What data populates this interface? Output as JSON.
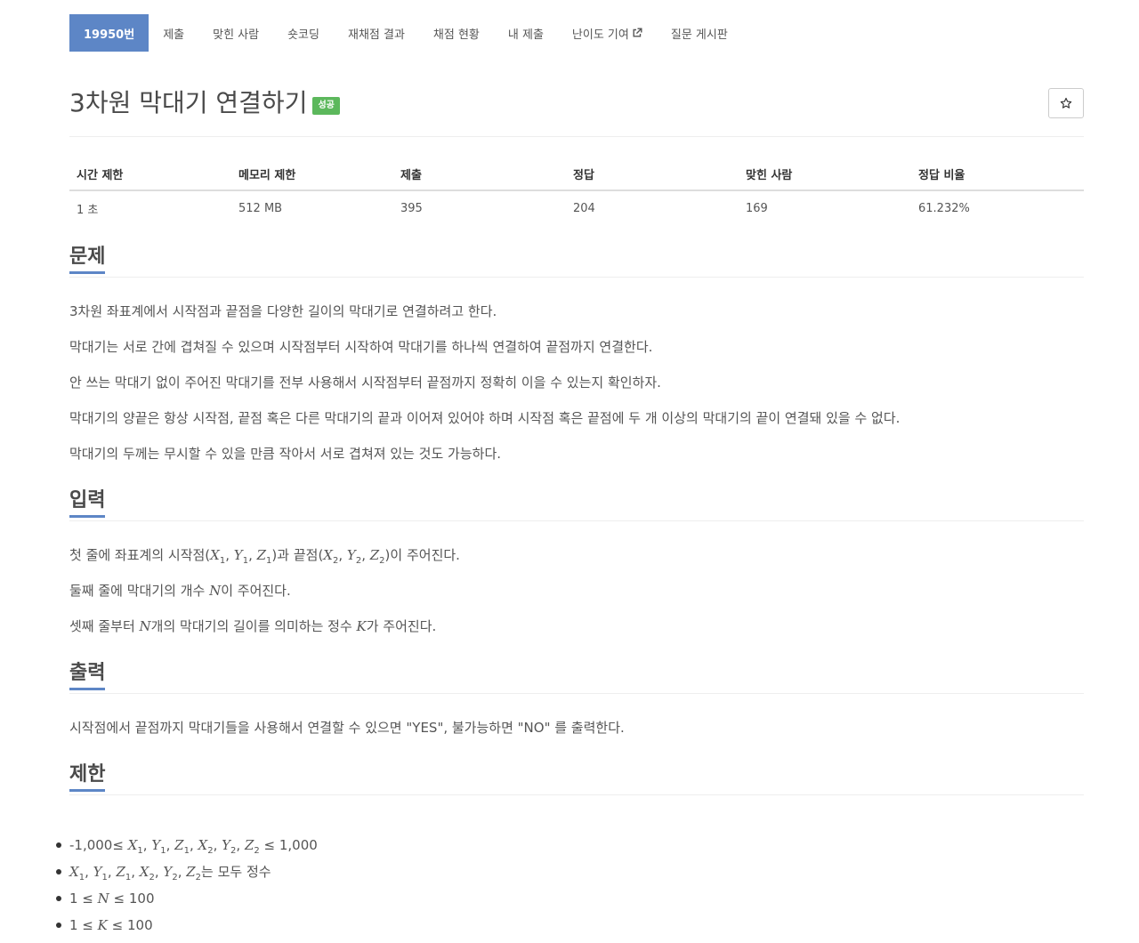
{
  "nav": {
    "items": [
      {
        "label": "19950번",
        "active": true
      },
      {
        "label": "제출"
      },
      {
        "label": "맞힌 사람"
      },
      {
        "label": "숏코딩"
      },
      {
        "label": "재채점 결과"
      },
      {
        "label": "채점 현황"
      },
      {
        "label": "내 제출"
      },
      {
        "label": "난이도 기여",
        "icon": "external-link-icon"
      },
      {
        "label": "질문 게시판"
      }
    ]
  },
  "problem": {
    "title": "3차원 막대기 연결하기",
    "badge": "성공",
    "star_icon": "star-icon"
  },
  "stats": {
    "headers": [
      "시간 제한",
      "메모리 제한",
      "제출",
      "정답",
      "맞힌 사람",
      "정답 비율"
    ],
    "values": [
      "1 초",
      "512 MB",
      "395",
      "204",
      "169",
      "61.232%"
    ]
  },
  "sections": {
    "description": {
      "title": "문제",
      "paragraphs": [
        "3차원 좌표계에서 시작점과 끝점을 다양한 길이의 막대기로 연결하려고 한다.",
        "막대기는 서로 간에 겹쳐질 수 있으며 시작점부터 시작하여 막대기를 하나씩 연결하여 끝점까지 연결한다.",
        "안 쓰는 막대기 없이 주어진 막대기를 전부 사용해서 시작점부터 끝점까지 정확히 이을 수 있는지 확인하자.",
        "막대기의 양끝은 항상 시작점, 끝점 혹은 다른 막대기의 끝과 이어져 있어야 하며 시작점 혹은 끝점에 두 개 이상의 막대기의 끝이 연결돼 있을 수 없다.",
        "막대기의 두께는 무시할 수 있을 만큼 작아서 서로 겹쳐져 있는 것도 가능하다."
      ]
    },
    "input": {
      "title": "입력",
      "line1_prefix": "첫 줄에 좌표계의 시작점(",
      "line1_mid": ")과 끝점(",
      "line1_suffix": ")이 주어진다.",
      "line2_prefix": "둘째 줄에 막대기의 개수 ",
      "line2_var": "N",
      "line2_suffix": "이 주어진다.",
      "line3_prefix": "셋째 줄부터 ",
      "line3_var1": "N",
      "line3_mid": "개의 막대기의 길이를 의미하는 정수 ",
      "line3_var2": "K",
      "line3_suffix": "가 주어진다."
    },
    "output": {
      "title": "출력",
      "text": "시작점에서 끝점까지 막대기들을 사용해서 연결할 수 있으면 \"YES\", 불가능하면 \"NO\" 를 출력한다."
    },
    "limits": {
      "title": "제한",
      "item1_prefix": "-1,000≤ ",
      "item1_suffix": " ≤ 1,000",
      "item2_suffix": "는 모두 정수",
      "item3_prefix": "1 ≤ ",
      "item3_var": "N",
      "item3_suffix": " ≤ 100",
      "item4_prefix": "1 ≤ ",
      "item4_var": "K",
      "item4_suffix": " ≤ 100"
    }
  }
}
